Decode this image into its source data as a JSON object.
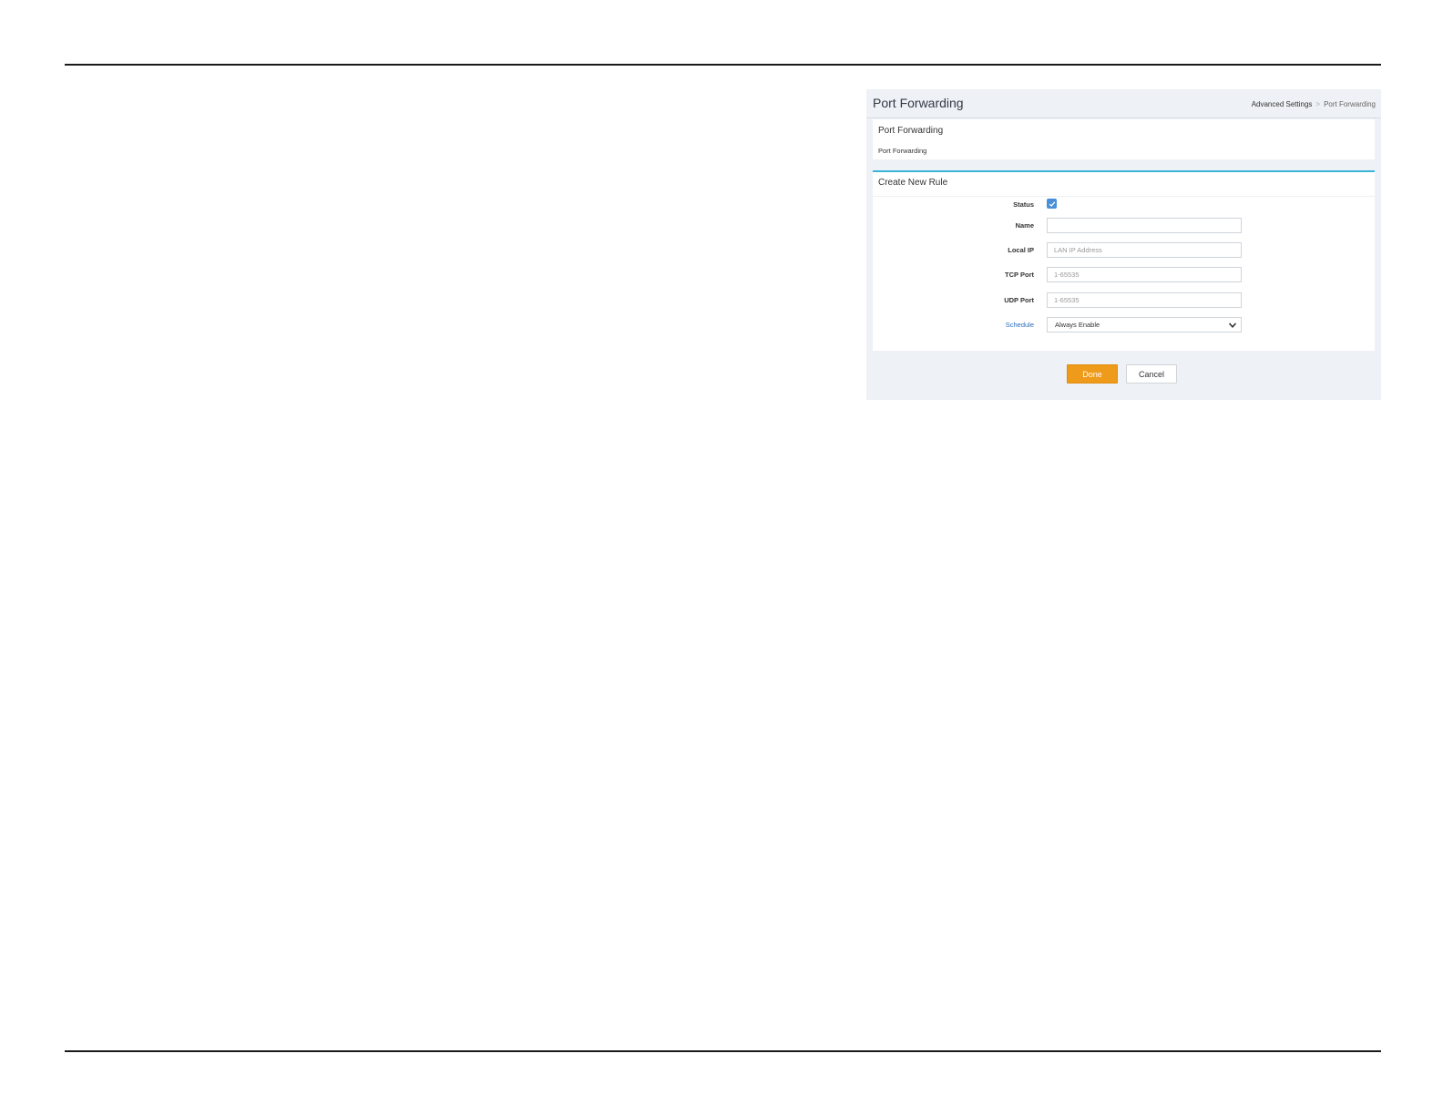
{
  "page": {
    "title": "Port Forwarding",
    "breadcrumb": {
      "parent": "Advanced Settings",
      "separator": ">",
      "current": "Port Forwarding"
    }
  },
  "info_card": {
    "title": "Port Forwarding",
    "subtitle": "Port Forwarding"
  },
  "rule_form": {
    "title": "Create New Rule",
    "status_label": "Status",
    "status_checked": true,
    "name_label": "Name",
    "name_value": "",
    "local_ip_label": "Local IP",
    "local_ip_placeholder": "LAN IP Address",
    "tcp_port_label": "TCP Port",
    "tcp_port_placeholder": "1-65535",
    "udp_port_label": "UDP Port",
    "udp_port_placeholder": "1-65535",
    "schedule_label": "Schedule",
    "schedule_value": "Always Enable"
  },
  "actions": {
    "done_label": "Done",
    "cancel_label": "Cancel"
  },
  "colors": {
    "accent_button": "#ee9a1a",
    "card_top_border": "#3bb4d8",
    "checkbox": "#4a90d9",
    "link": "#2a6ebb"
  }
}
